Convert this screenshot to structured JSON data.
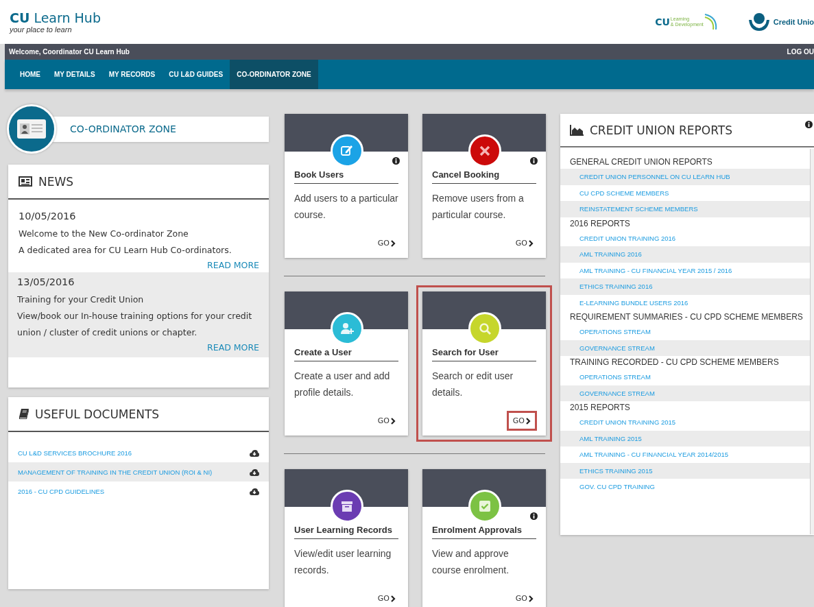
{
  "header": {
    "logo_title": "**CU** Learn Hub",
    "tagline": "your place to learn",
    "partner_logo": {
      "mark": "CU",
      "line_1": "Learning",
      "line_2": "& Development"
    },
    "union_logo": "Credit Unio"
  },
  "welcome_bar": {
    "text": "Welcome, Coordinator CU Learn Hub",
    "logout": "LOG OU"
  },
  "nav": [
    {
      "label": "HOME",
      "selected": false
    },
    {
      "label": "MY DETAILS",
      "selected": false
    },
    {
      "label": "MY RECORDS",
      "selected": false
    },
    {
      "label": "CU L&D GUIDES",
      "selected": false
    },
    {
      "label": "CO-ORDINATOR ZONE",
      "selected": true
    }
  ],
  "zone": {
    "title": "CO-ORDINATOR ZONE"
  },
  "news": {
    "title": "NEWS",
    "items": [
      {
        "date": "10/05/2016",
        "lines": [
          "Welcome to the New Co-ordinator Zone",
          "A dedicated area for CU Learn Hub Co-ordinators."
        ],
        "link": "READ MORE",
        "shaded": false
      },
      {
        "date": "13/05/2016",
        "lines": [
          "Training for your Credit Union",
          "View/book our In-house training options for your credit union / cluster of credit unions or chapter."
        ],
        "link": "READ MORE",
        "shaded": true
      }
    ]
  },
  "documents": {
    "title": "USEFUL DOCUMENTS",
    "items": [
      {
        "label": "CU L&D SERVICES BROCHURE 2016"
      },
      {
        "label": "MANAGEMENT OF TRAINING IN THE CREDIT UNION (ROI & NI)"
      },
      {
        "label": "2016 - CU CPD GUIDELINES"
      }
    ]
  },
  "tiles": [
    {
      "title": "Book Users",
      "description": "Add users to a particular course.",
      "go": "GO",
      "kind": "edit",
      "color": "#1ba3e6",
      "info": true,
      "highlighted": false
    },
    {
      "title": "Cancel Booking",
      "description": "Remove users from a particular course.",
      "go": "GO",
      "kind": "cross",
      "color": "#cc0a0a",
      "info": true,
      "highlighted": false
    },
    {
      "title": "Create a User",
      "description": "Create a user and add profile details.",
      "go": "GO",
      "kind": "add-user",
      "color": "#2bbcd6",
      "info": false,
      "highlighted": false
    },
    {
      "title": "Search for User",
      "description": "Search or edit user details.",
      "go": "GO",
      "kind": "search",
      "color": "#c6d62c",
      "info": false,
      "highlighted": true
    },
    {
      "title": "User Learning Records",
      "description": "View/edit user learning records.",
      "go": "GO",
      "kind": "archive",
      "color": "#6b3cb2",
      "info": false,
      "highlighted": false
    },
    {
      "title": "Enrolment Approvals",
      "description": "View and approve course enrolment.",
      "go": "GO",
      "kind": "check",
      "color": "#7cc244",
      "info": true,
      "highlighted": false
    }
  ],
  "reports": {
    "title": "CREDIT UNION REPORTS",
    "groups": [
      {
        "heading": "GENERAL CREDIT UNION REPORTS",
        "items": [
          {
            "label": "CREDIT UNION PERSONNEL ON CU LEARN HUB",
            "shaded": true
          },
          {
            "label": "CU CPD SCHEME MEMBERS",
            "shaded": false
          },
          {
            "label": "REINSTATEMENT SCHEME MEMBERS",
            "shaded": true
          }
        ]
      },
      {
        "heading": "2016 REPORTS",
        "items": [
          {
            "label": "CREDIT UNION TRAINING 2016",
            "shaded": false
          },
          {
            "label": "AML TRAINING 2016",
            "shaded": true
          },
          {
            "label": "AML TRAINING - CU FINANCIAL YEAR 2015 / 2016",
            "shaded": false
          },
          {
            "label": "ETHICS TRAINING 2016",
            "shaded": true
          },
          {
            "label": "E-LEARNING BUNDLE USERS 2016",
            "shaded": false
          }
        ]
      },
      {
        "heading": "REQUIREMENT SUMMARIES - CU CPD SCHEME MEMBERS",
        "items": [
          {
            "label": "OPERATIONS STREAM",
            "shaded": false
          },
          {
            "label": "GOVERNANCE STREAM",
            "shaded": true
          }
        ]
      },
      {
        "heading": "TRAINING RECORDED - CU CPD SCHEME MEMBERS",
        "items": [
          {
            "label": "OPERATIONS STREAM",
            "shaded": false
          },
          {
            "label": "GOVERNANCE STREAM",
            "shaded": true
          }
        ]
      },
      {
        "heading": "2015 REPORTS",
        "items": [
          {
            "label": "CREDIT UNION TRAINING 2015",
            "shaded": false
          },
          {
            "label": "AML TRAINING 2015",
            "shaded": true
          },
          {
            "label": "AML TRAINING - CU FINANCIAL YEAR 2014/2015",
            "shaded": false
          },
          {
            "label": "ETHICS TRAINING 2015",
            "shaded": true
          },
          {
            "label": "GOV. CU CPD TRAINING",
            "shaded": false
          }
        ]
      }
    ]
  }
}
